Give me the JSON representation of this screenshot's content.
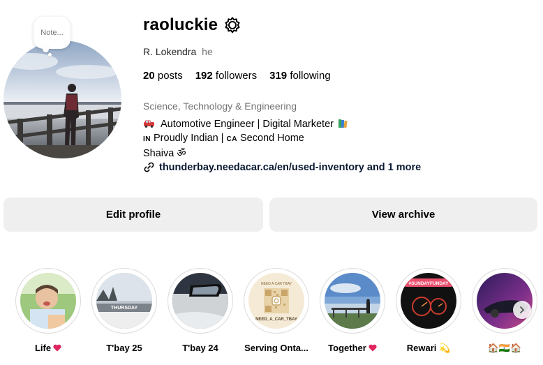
{
  "profile": {
    "username": "raoluckie",
    "full_name": "R. Lokendra",
    "pronouns": "he",
    "note_placeholder": "Note...",
    "stats": {
      "posts_count": "20",
      "posts_label": "posts",
      "followers_count": "192",
      "followers_label": "followers",
      "following_count": "319",
      "following_label": "following"
    },
    "category": "Science, Technology & Engineering",
    "bio": {
      "line1": "Automotive Engineer | Digital Marketer",
      "line2_code1": "IN",
      "line2_text1": "Proudly Indian |",
      "line2_code2": "CA",
      "line2_text2": "Second Home",
      "line3": "Shaiva ॐ"
    },
    "link": "thunderbay.needacar.ca/en/used-inventory and 1 more"
  },
  "actions": {
    "edit_profile": "Edit profile",
    "view_archive": "View archive"
  },
  "highlights": [
    {
      "label": "Life",
      "emoji": "heart"
    },
    {
      "label": "T'bay 25"
    },
    {
      "label": "T'bay 24"
    },
    {
      "label": "Serving Onta..."
    },
    {
      "label": "Together",
      "emoji": "heart"
    },
    {
      "label": "Rewari 💫"
    },
    {
      "label": "🏠🇮🇳🏠"
    }
  ],
  "highlight_texts": {
    "thursday": "THURSDAY",
    "sunday_funday": "#SUNDAYFUNDAY",
    "need_a_car": "NEED_A_CAR_TBAY",
    "needacar_small": "NEED A CAR TBAY"
  },
  "icons": {
    "settings": "gear-icon",
    "link": "link-icon",
    "next": "chevron-right-icon"
  }
}
